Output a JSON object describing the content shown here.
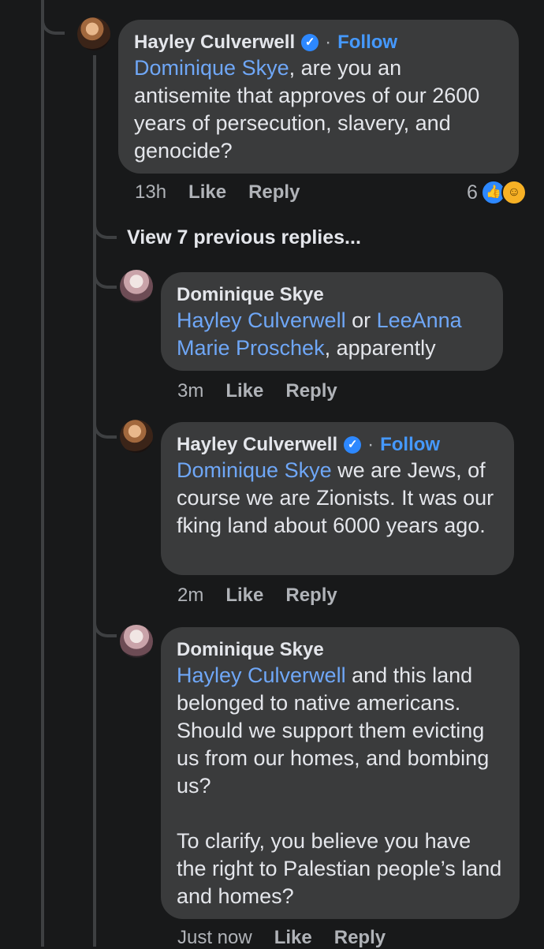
{
  "colors": {
    "background": "#18191a",
    "bubble": "#3a3b3c",
    "link": "#6fa7f7",
    "follow": "#4599ff",
    "verified": "#2d88ff",
    "muted": "#b0b3b8"
  },
  "comments": [
    {
      "author": "Hayley Culverwell",
      "verified": true,
      "separator": "·",
      "follow_label": "Follow",
      "mention": "Dominique Skye",
      "text": ", are you an antisemite that approves of our 2600 years of persecution, slavery, and genocide?",
      "time": "13h",
      "like_label": "Like",
      "reply_label": "Reply",
      "reaction_count": "6",
      "reaction_icons": [
        "like-reaction-icon",
        "care-reaction-icon"
      ]
    }
  ],
  "view_previous_replies": "View 7 previous replies...",
  "replies": [
    {
      "author": "Dominique Skye",
      "mention1": "Hayley Culverwell",
      "connector": " or ",
      "mention2": "LeeAnna Marie Proschek",
      "text": ", apparently",
      "time": "3m",
      "like_label": "Like",
      "reply_label": "Reply"
    },
    {
      "author": "Hayley Culverwell",
      "verified": true,
      "separator": "·",
      "follow_label": "Follow",
      "mention": "Dominique Skye",
      "text": " we are Jews, of course we are Zionists. It was our fking land about 6000 years ago.",
      "time": "2m",
      "like_label": "Like",
      "reply_label": "Reply"
    },
    {
      "author": "Dominique Skye",
      "mention": "Hayley Culverwell",
      "text": " and this land belonged to native americans. Should we support them evicting us from our homes, and bombing us?",
      "text2": "To clarify, you believe you have the right to Palestian people’s land and homes?",
      "time": "Just now",
      "like_label": "Like",
      "reply_label": "Reply"
    }
  ]
}
